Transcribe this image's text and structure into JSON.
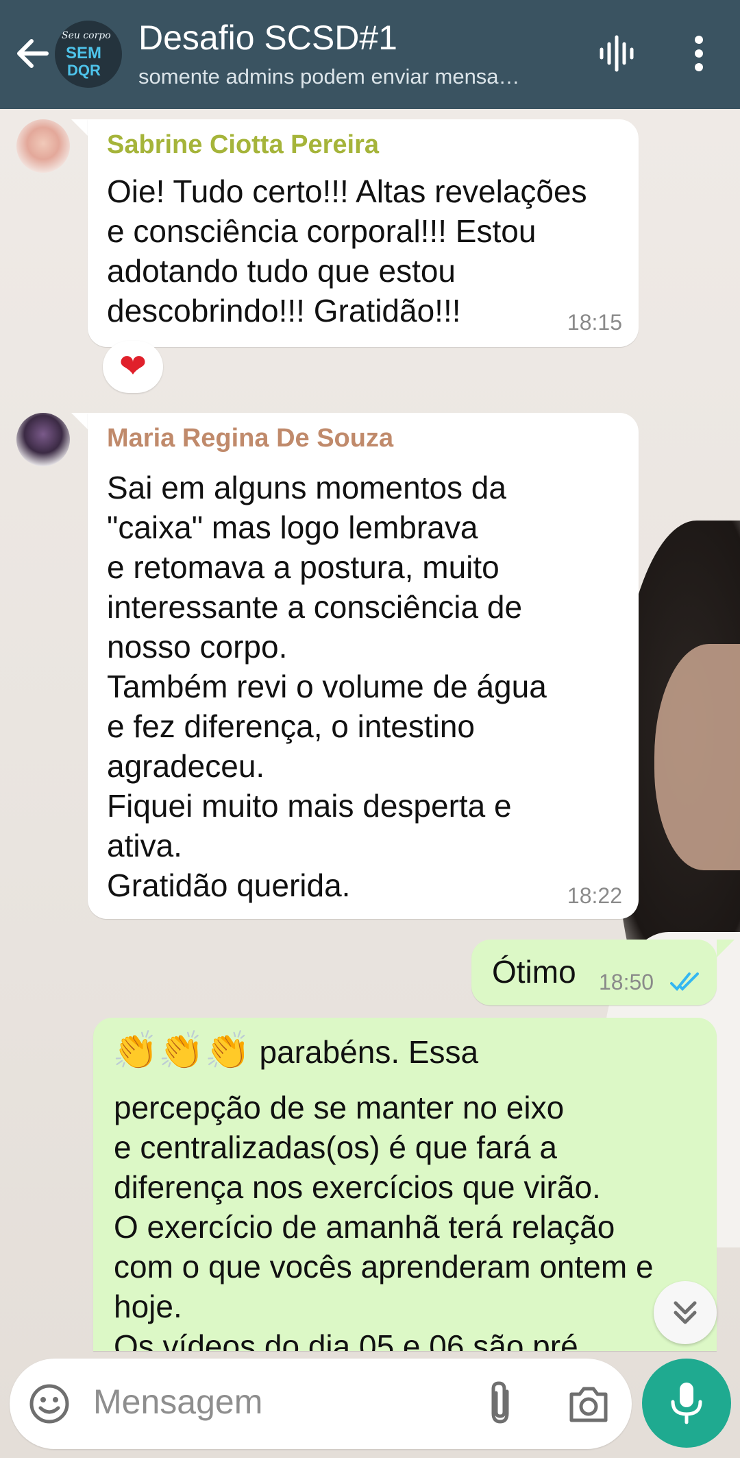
{
  "header": {
    "title": "Desafio SCSD#1",
    "subtitle": "somente admins podem enviar mensa…",
    "group_avatar": {
      "line1": "Seu corpo",
      "line2": "SEM",
      "line3": "DQR"
    }
  },
  "messages": [
    {
      "sender": "Sabrine Ciotta Pereira",
      "sender_color": "#a5b43a",
      "text": "Oie! Tudo certo!!! Altas revelações\ne consciência corporal!!! Estou\nadotando tudo que estou\ndescobrindo!!! Gratidão!!!",
      "time": "18:15",
      "reaction": "❤"
    },
    {
      "sender": "Maria Regina De Souza",
      "sender_color": "#c08a6b",
      "text": "Sai em alguns momentos da\n\"caixa\" mas logo lembrava\ne retomava a postura, muito\ninteressante a consciência de\nnosso corpo.\nTambém revi o volume de água\ne fez diferença,  o intestino\nagradeceu.\nFiquei muito mais desperta e\nativa.\nGratidão querida.",
      "time": "18:22"
    },
    {
      "text": "Ótimo",
      "time": "18:50",
      "status": "read"
    },
    {
      "emoji": "👏👏👏",
      "first_line": " parabéns. Essa",
      "text": "percepção de se manter no eixo\ne centralizadas(os) é que fará a\ndiferença nos exercícios que virão.\nO exercício de amanhã terá relação\ncom o que vocês aprenderam ontem e\nhoje.\nOs vídeos do dia 05 e 06 são pré"
    }
  ],
  "input": {
    "placeholder": "Mensagem"
  },
  "colors": {
    "header": "#3a5361",
    "accent": "#1faa90",
    "outgoing": "#dcf8c6",
    "read_tick": "#34b7f1"
  }
}
